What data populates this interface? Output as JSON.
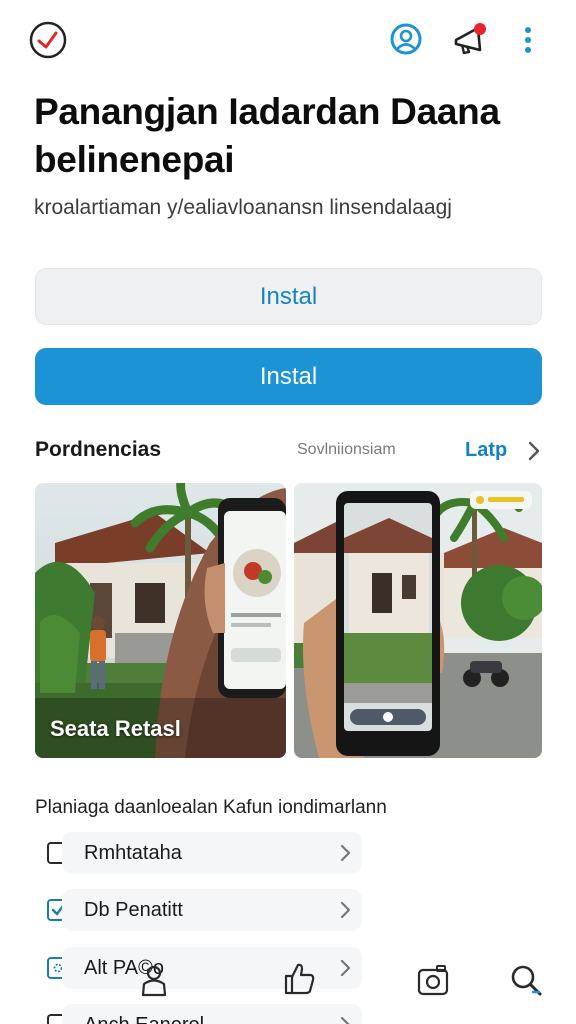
{
  "header": {
    "icons": [
      "back-check-icon",
      "chat-icon",
      "megaphone-icon",
      "more-vertical-icon"
    ],
    "notification_dot_color": "#e8242a"
  },
  "title": "Panangjan Iadardan Daana belinenepai",
  "subtitle": "kroalartiaman y/ealiavloanansn linsendalaagj",
  "buttons": {
    "secondary_label": "Instal",
    "primary_label": "Instal"
  },
  "section": {
    "title": "Pordnencias",
    "middle_text": "Sovlniionsiam",
    "link_label": "Latp"
  },
  "cards": [
    {
      "caption": "Seata Retasl"
    },
    {
      "caption": ""
    }
  ],
  "list": {
    "title": "Planiaga daanloealan Kafun iondimarlann",
    "items": [
      {
        "label": "Rmhtataha",
        "checked": false
      },
      {
        "label": "Db Penatitt",
        "checked": true
      },
      {
        "label": "Alt PA©o",
        "checked": false
      },
      {
        "label": "Anch Eanerol",
        "checked": false
      }
    ]
  },
  "colors": {
    "accent": "#1c93d4",
    "link": "#1583c2"
  },
  "bottom_nav": [
    "user-icon",
    "thumbs-up-icon",
    "camera-icon",
    "search-icon"
  ]
}
